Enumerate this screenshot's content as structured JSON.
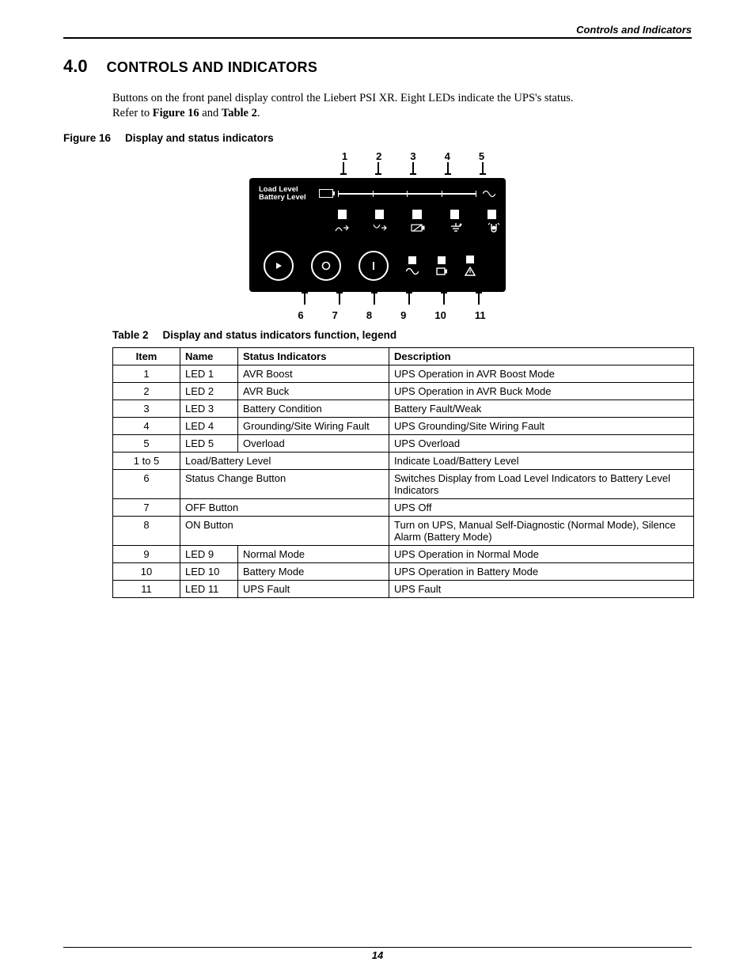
{
  "header": {
    "running": "Controls and Indicators"
  },
  "section": {
    "number": "4.0",
    "title": "CONTROLS AND INDICATORS"
  },
  "intro": {
    "line1": "Buttons on the front panel display control the Liebert PSI XR. Eight LEDs indicate the UPS's status.",
    "line2a": "Refer to ",
    "fig_ref": "Figure 16",
    "line2b": " and ",
    "tab_ref": "Table 2",
    "line2c": "."
  },
  "figure": {
    "label": "Figure 16",
    "caption": "Display and status indicators",
    "top_callouts": [
      "1",
      "2",
      "3",
      "4",
      "5"
    ],
    "bottom_callouts": [
      "6",
      "7",
      "8",
      "9",
      "10",
      "11"
    ],
    "panel_labels": {
      "load": "Load Level",
      "battery": "Battery Level"
    }
  },
  "table": {
    "label": "Table 2",
    "caption": "Display and status indicators function, legend",
    "headers": {
      "item": "Item",
      "name": "Name",
      "status": "Status Indicators",
      "desc": "Description"
    },
    "rows": [
      {
        "item": "1",
        "name": "LED 1",
        "status": "AVR Boost",
        "desc": "UPS Operation in AVR Boost Mode"
      },
      {
        "item": "2",
        "name": "LED 2",
        "status": "AVR Buck",
        "desc": "UPS Operation in AVR Buck Mode"
      },
      {
        "item": "3",
        "name": "LED 3",
        "status": "Battery Condition",
        "desc": "Battery Fault/Weak"
      },
      {
        "item": "4",
        "name": "LED 4",
        "status": "Grounding/Site Wiring Fault",
        "desc": "UPS Grounding/Site Wiring Fault"
      },
      {
        "item": "5",
        "name": "LED 5",
        "status": "Overload",
        "desc": "UPS Overload"
      },
      {
        "item": "1 to 5",
        "merged": "Load/Battery Level",
        "desc": "Indicate Load/Battery Level"
      },
      {
        "item": "6",
        "merged": "Status Change Button",
        "desc": "Switches Display from Load Level Indicators to Battery Level Indicators"
      },
      {
        "item": "7",
        "merged": "OFF Button",
        "desc": "UPS Off"
      },
      {
        "item": "8",
        "merged": "ON Button",
        "desc": "Turn on UPS, Manual Self-Diagnostic (Normal Mode), Silence Alarm (Battery Mode)"
      },
      {
        "item": "9",
        "name": "LED 9",
        "status": "Normal Mode",
        "desc": "UPS Operation in Normal Mode"
      },
      {
        "item": "10",
        "name": "LED 10",
        "status": "Battery Mode",
        "desc": "UPS Operation in Battery Mode"
      },
      {
        "item": "11",
        "name": "LED 11",
        "status": "UPS Fault",
        "desc": "UPS Fault"
      }
    ]
  },
  "footer": {
    "page": "14"
  }
}
